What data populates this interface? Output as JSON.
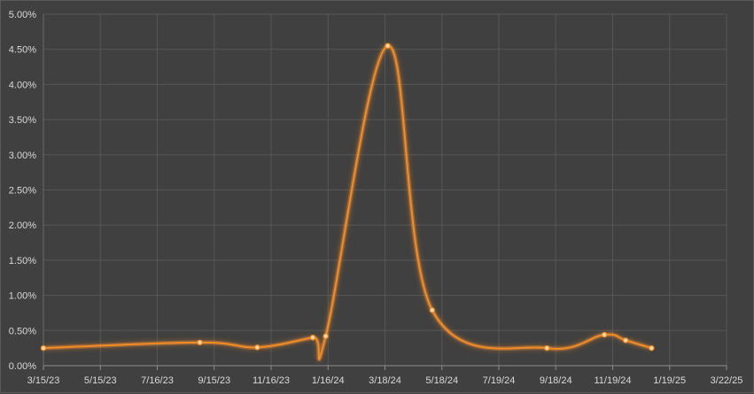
{
  "chart_data": {
    "type": "line",
    "title": "",
    "xlabel": "",
    "ylabel": "",
    "x_axis": {
      "type": "date",
      "min": "2023-03-15",
      "max": "2025-03-22",
      "tick_labels": [
        "3/15/23",
        "5/15/23",
        "7/16/23",
        "9/15/23",
        "11/16/23",
        "1/16/24",
        "3/18/24",
        "5/18/24",
        "7/19/24",
        "9/18/24",
        "11/19/24",
        "1/19/25",
        "3/22/25"
      ]
    },
    "y_axis": {
      "min": 0,
      "max": 0.05,
      "format": "percent",
      "tick_labels": [
        "0.00%",
        "0.50%",
        "1.00%",
        "1.50%",
        "2.00%",
        "2.50%",
        "3.00%",
        "3.50%",
        "4.00%",
        "4.50%",
        "5.00%"
      ]
    },
    "grid": true,
    "legend": "none",
    "smooth": true,
    "line_color": "#f28c28",
    "series": [
      {
        "points": [
          {
            "x": "2023-03-15",
            "y": 0.0025
          },
          {
            "x": "2023-08-31",
            "y": 0.0033
          },
          {
            "x": "2023-11-01",
            "y": 0.0026
          },
          {
            "x": "2023-12-31",
            "y": 0.004
          },
          {
            "x": "2024-01-14",
            "y": 0.0042
          },
          {
            "x": "2024-03-21",
            "y": 0.0455
          },
          {
            "x": "2024-05-08",
            "y": 0.0079
          },
          {
            "x": "2024-09-09",
            "y": 0.0025
          },
          {
            "x": "2024-11-10",
            "y": 0.0044
          },
          {
            "x": "2024-12-03",
            "y": 0.0036
          },
          {
            "x": "2024-12-31",
            "y": 0.0025
          }
        ]
      }
    ]
  }
}
